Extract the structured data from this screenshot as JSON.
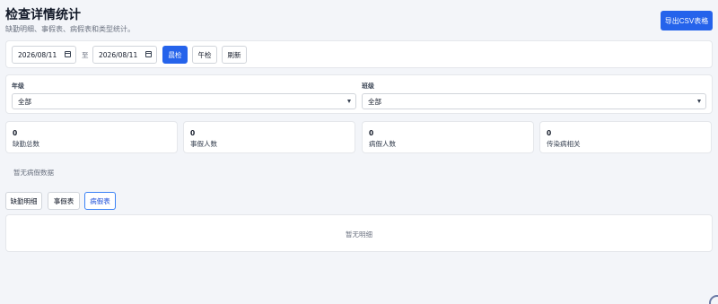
{
  "header": {
    "title": "检查详情统计",
    "subtitle": "缺勤明细、事假表、病假表和类型统计。",
    "export_label": "导出CSV表格"
  },
  "toolbar": {
    "start_date": "2026/08/11",
    "to_label": "至",
    "end_date": "2026/08/11",
    "buttons": {
      "morning": "晨检",
      "noon": "午检",
      "refresh": "刷新"
    }
  },
  "filters": {
    "grade": {
      "label": "年级",
      "value": "全部"
    },
    "class": {
      "label": "班级",
      "value": "全部"
    }
  },
  "stats": [
    {
      "value": "0",
      "label": "缺勤总数"
    },
    {
      "value": "0",
      "label": "事假人数"
    },
    {
      "value": "0",
      "label": "病假人数"
    },
    {
      "value": "0",
      "label": "传染病相关"
    }
  ],
  "sick_empty": "暂无病假数据",
  "tabs": [
    {
      "label": "缺勤明细",
      "active": false
    },
    {
      "label": "事假表",
      "active": false
    },
    {
      "label": "病假表",
      "active": true
    }
  ],
  "detail_empty": "暂无明细",
  "colors": {
    "primary": "#2563eb",
    "background": "#f3f5f9"
  }
}
